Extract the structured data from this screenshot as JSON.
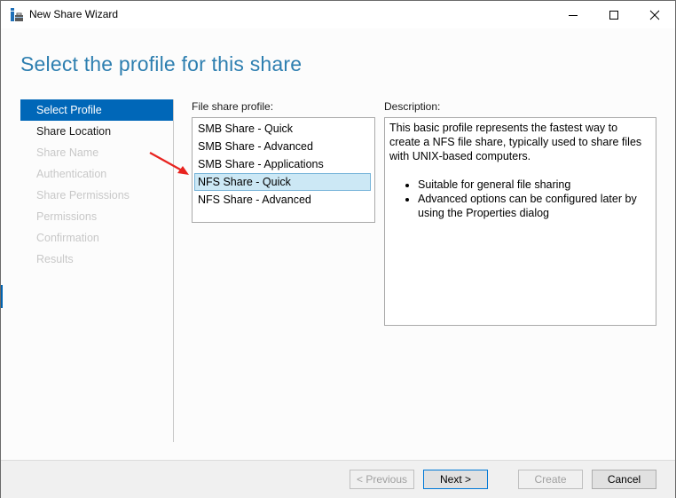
{
  "window": {
    "title": "New Share Wizard",
    "app_icon": "server-manager-share-icon",
    "controls": [
      "minimize-icon",
      "maximize-icon",
      "close-icon"
    ]
  },
  "page": {
    "title": "Select the profile for this share"
  },
  "nav": {
    "items": [
      {
        "label": "Select Profile",
        "state": "active"
      },
      {
        "label": "Share Location",
        "state": "enabled"
      },
      {
        "label": "Share Name",
        "state": "disabled"
      },
      {
        "label": "Authentication",
        "state": "disabled"
      },
      {
        "label": "Share Permissions",
        "state": "disabled"
      },
      {
        "label": "Permissions",
        "state": "disabled"
      },
      {
        "label": "Confirmation",
        "state": "disabled"
      },
      {
        "label": "Results",
        "state": "disabled"
      }
    ]
  },
  "profile": {
    "label": "File share profile:",
    "items": [
      {
        "label": "SMB Share - Quick",
        "selected": false
      },
      {
        "label": "SMB Share - Advanced",
        "selected": false
      },
      {
        "label": "SMB Share - Applications",
        "selected": false
      },
      {
        "label": "NFS Share - Quick",
        "selected": true
      },
      {
        "label": "NFS Share - Advanced",
        "selected": false
      }
    ]
  },
  "description": {
    "label": "Description:",
    "text": "This basic profile represents the fastest way to create a NFS file share, typically used to share files with UNIX-based computers.",
    "bullets": [
      "Suitable for general file sharing",
      "Advanced options can be configured later by using the Properties dialog"
    ]
  },
  "annotation": {
    "arrow_color": "#e8231f",
    "points_to": "NFS Share - Quick"
  },
  "buttons": {
    "previous": "< Previous",
    "next": "Next >",
    "create": "Create",
    "cancel": "Cancel"
  },
  "colors": {
    "accent": "#0067b8",
    "title": "#2e7fb0",
    "selection": "#cce8f5"
  }
}
